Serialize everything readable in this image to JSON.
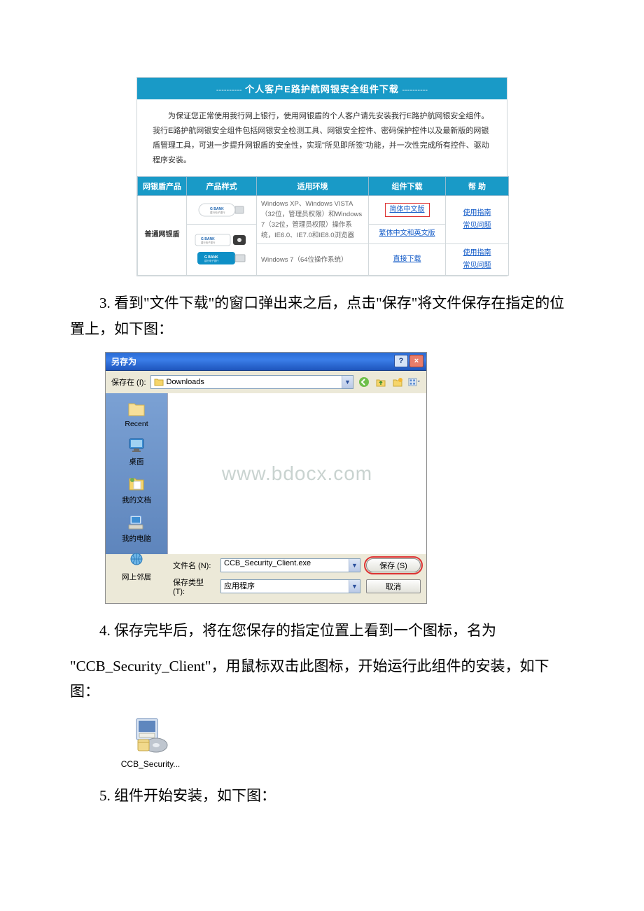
{
  "download_page": {
    "title_mid": "个人客户E路护航网银安全组件下载",
    "title_dashes": "----------",
    "description": "为保证您正常使用我行网上银行，使用网银盾的个人客户请先安装我行E路护航网银安全组件。我行E路护航网银安全组件包括网银安全检测工具、网银安全控件、密码保护控件以及最新版的网银盾管理工具，可进一步提升网银盾的安全性，实现\"所见即所签\"功能，并一次性完成所有控件、驱动程序安装。",
    "headers": {
      "product": "网银盾产品",
      "style": "产品样式",
      "env": "适用环境",
      "dl": "组件下载",
      "help": "帮 助"
    },
    "row_product": "普通网银盾",
    "env1": "Windows XP、Windows VISTA（32位，管理员权限）和Windows 7（32位，管理员权限）操作系统，IE6.0、IE7.0和IE8.0浏览器",
    "dl1a": "简体中文版",
    "dl1b": "繁体中文和英文版",
    "help1a": "使用指南",
    "help1b": "常见问题",
    "env2": "Windows 7（64位操作系统）",
    "dl2": "直接下载",
    "help2a": "使用指南",
    "help2b": "常见问题"
  },
  "step3": "3. 看到\"文件下载\"的窗口弹出来之后，点击\"保存\"将文件保存在指定的位置上，如下图：",
  "saveas": {
    "title": "另存为",
    "savein_label": "保存在 (I):",
    "folder": "Downloads",
    "places": {
      "recent": "Recent",
      "desktop": "桌面",
      "mydocs": "我的文档",
      "mycomputer": "我的电脑",
      "network": "网上邻居"
    },
    "filename_label": "文件名 (N):",
    "filename_value": "CCB_Security_Client.exe",
    "filetype_label": "保存类型 (T):",
    "filetype_value": "应用程序",
    "save_btn": "保存 (S)",
    "cancel_btn": "取消",
    "watermark": "www.bdocx.com"
  },
  "step4_a": "4. 保存完毕后，将在您保存的指定位置上看到一个图标，名为",
  "step4_b": "\"CCB_Security_Client\"，用鼠标双击此图标，开始运行此组件的安装，如下图：",
  "installer_label": "CCB_Security...",
  "step5": "5. 组件开始安装，如下图："
}
